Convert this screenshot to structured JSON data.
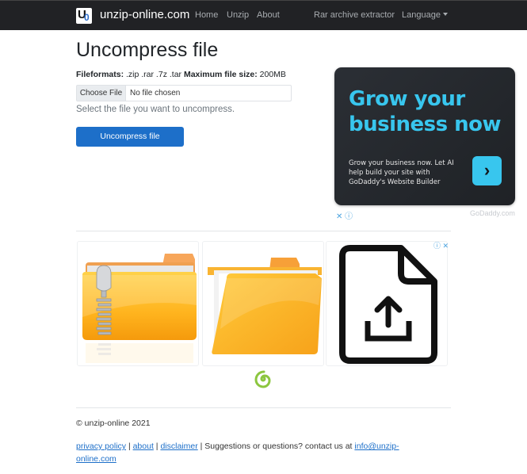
{
  "navbar": {
    "logo_letters": {
      "u": "U",
      "o": "0"
    },
    "brand": "unzip-online.com",
    "links": [
      "Home",
      "Unzip",
      "About"
    ],
    "right_links": [
      "Rar archive extractor"
    ],
    "language_label": "Language"
  },
  "main": {
    "title": "Uncompress file",
    "formats_label": "Fileformats:",
    "formats_value": " .zip .rar .7z .tar ",
    "max_size_label": "Maximum file size:",
    "max_size_value": " 200MB",
    "file_input": {
      "button_label": "Choose File",
      "status": "No file chosen"
    },
    "help_text": "Select the file you want to uncompress.",
    "submit_label": "Uncompress file"
  },
  "ad": {
    "headline": "Grow your business now",
    "body": "Grow your business now. Let AI help build your site with GoDaddy's Website Builder",
    "cta_glyph": "›",
    "controls": "✕ ⓘ",
    "sponsor": "GoDaddy.com",
    "brand_color": "#38c6ee"
  },
  "image_ad": {
    "tiles": [
      "zip-folder-icon",
      "open-folder-icon",
      "file-upload-icon"
    ],
    "controls": "ⓘ ✕"
  },
  "footer": {
    "copyright": "© unzip-online 2021",
    "links": [
      "privacy policy",
      "about",
      "disclaimer"
    ],
    "separator": " | ",
    "contact_text": " | Suggestions or questions? contact us at ",
    "email": "info@unzip-online.com"
  },
  "colors": {
    "navbar_bg": "#212225",
    "primary": "#1d6fc9",
    "link": "#1d6fc9"
  }
}
